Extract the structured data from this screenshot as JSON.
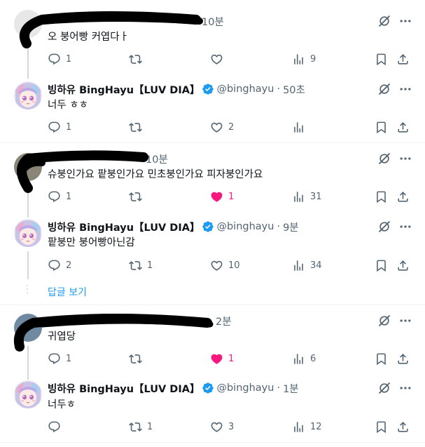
{
  "tweets": [
    {
      "time": "10분",
      "text": "오 붕어빵 커엽다ㅏ",
      "replies": "1",
      "retweets": "",
      "likes": "",
      "views": "9",
      "liked": false
    },
    {
      "name": "빙하유 BingHayu【LUV DIA】",
      "handle": "@binghayu",
      "dot": "·",
      "time": "50초",
      "text": "너두 ㅎㅎ",
      "replies": "1",
      "retweets": "",
      "likes": "2",
      "views": "",
      "liked": false
    },
    {
      "time": "10분",
      "text": "슈붕인가요 팥붕인가요 민초붕인가요 피자붕인가요",
      "replies": "1",
      "retweets": "",
      "likes": "1",
      "views": "31",
      "liked": true
    },
    {
      "name": "빙하유 BingHayu【LUV DIA】",
      "handle": "@binghayu",
      "dot": "·",
      "time": "9분",
      "text": "팥붕만 붕어빵아닌감",
      "replies": "2",
      "retweets": "1",
      "likes": "10",
      "views": "34",
      "liked": false
    },
    {
      "time": "2분",
      "text": "귀엽당",
      "replies": "1",
      "retweets": "",
      "likes": "1",
      "views": "6",
      "liked": true
    },
    {
      "name": "빙하유 BingHayu【LUV DIA】",
      "handle": "@binghayu",
      "dot": "·",
      "time": "1분",
      "text": "너두ㅎ",
      "replies": "",
      "retweets": "1",
      "likes": "3",
      "views": "12",
      "liked": false
    }
  ],
  "show_replies_label": "답글 보기",
  "colors": {
    "accent": "#1d9bf0",
    "like": "#f91880",
    "muted": "#536471",
    "verified": "#1d9bf0"
  },
  "icons": [
    "reply-icon",
    "retweet-icon",
    "like-icon",
    "views-icon",
    "bookmark-icon",
    "share-icon",
    "grok-icon",
    "more-icon",
    "verified-icon"
  ]
}
